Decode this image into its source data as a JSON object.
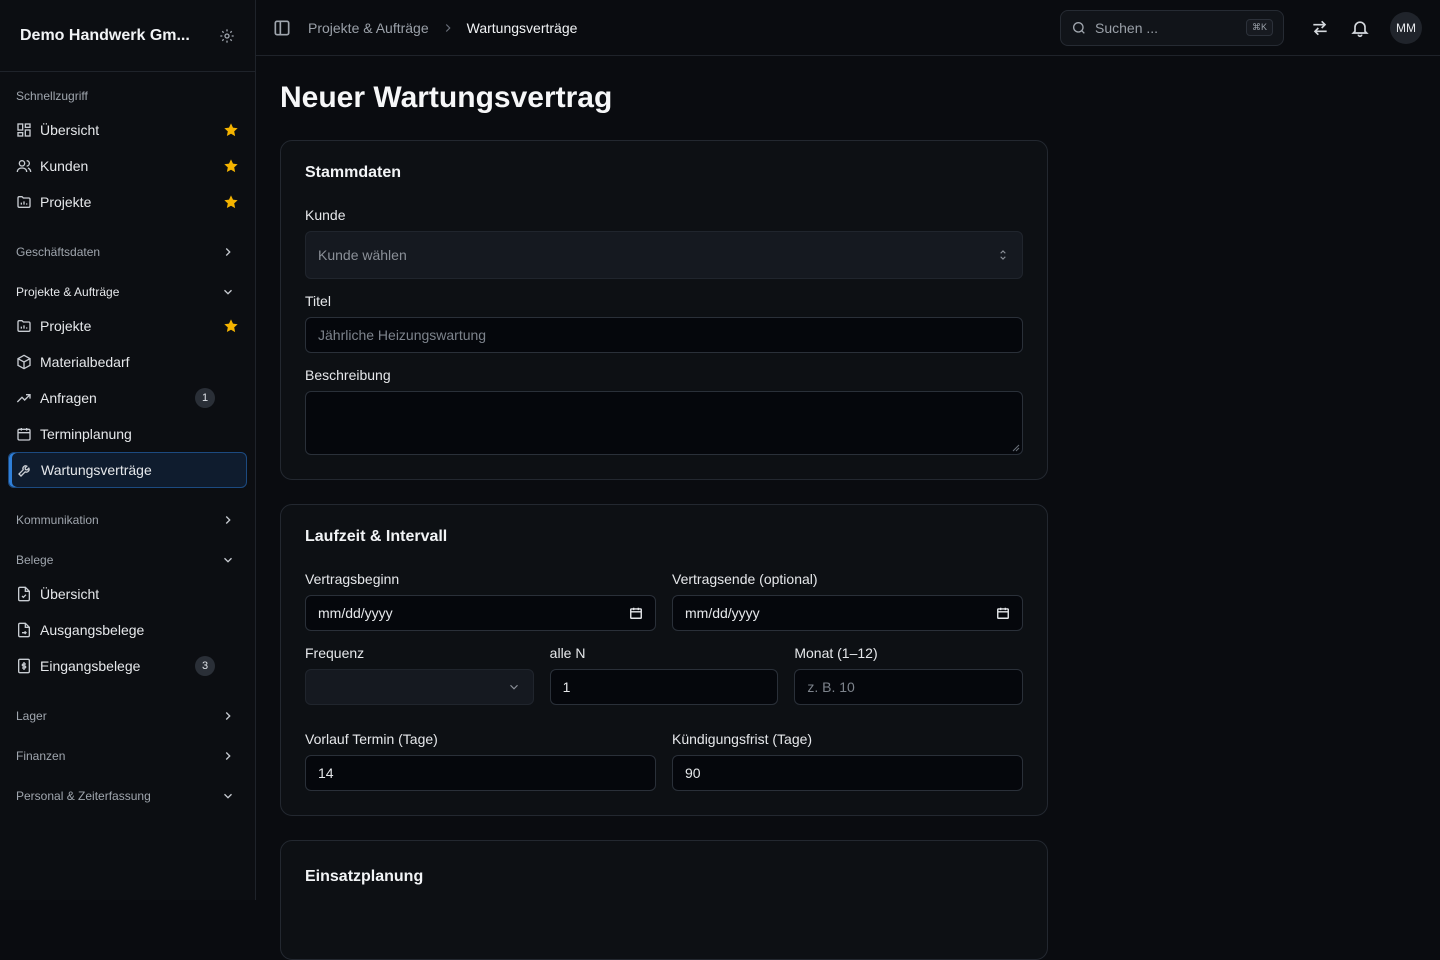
{
  "sidebar": {
    "company": "Demo Handwerk Gm...",
    "quick_access": {
      "title": "Schnellzugriff",
      "items": [
        {
          "label": "Übersicht"
        },
        {
          "label": "Kunden"
        },
        {
          "label": "Projekte"
        }
      ]
    },
    "groups": {
      "business": "Geschäftsdaten",
      "projects": {
        "title": "Projekte & Aufträge",
        "items": [
          {
            "label": "Projekte"
          },
          {
            "label": "Materialbedarf"
          },
          {
            "label": "Anfragen",
            "badge": "1"
          },
          {
            "label": "Terminplanung"
          },
          {
            "label": "Wartungsverträge"
          }
        ]
      },
      "communication": "Kommunikation",
      "documents": {
        "title": "Belege",
        "items": [
          {
            "label": "Übersicht"
          },
          {
            "label": "Ausgangsbelege"
          },
          {
            "label": "Eingangsbelege",
            "badge": "3"
          }
        ]
      },
      "stock": "Lager",
      "finance": "Finanzen",
      "personnel": "Personal & Zeiterfassung"
    }
  },
  "topbar": {
    "breadcrumb": [
      "Projekte & Aufträge",
      "Wartungsverträge"
    ],
    "search_placeholder": "Suchen ...",
    "search_shortcut": "⌘K",
    "avatar_initials": "MM"
  },
  "page": {
    "title": "Neuer Wartungsvertrag",
    "master": {
      "title": "Stammdaten",
      "customer_label": "Kunde",
      "customer_placeholder": "Kunde wählen",
      "title_label": "Titel",
      "title_placeholder": "Jährliche Heizungswartung",
      "description_label": "Beschreibung"
    },
    "term": {
      "title": "Laufzeit & Intervall",
      "start_label": "Vertragsbeginn",
      "start_value": "mm/dd/yyyy",
      "end_label": "Vertragsende (optional)",
      "end_value": "mm/dd/yyyy",
      "frequency_label": "Frequenz",
      "every_n_label": "alle N",
      "every_n_value": "1",
      "month_label": "Monat (1–12)",
      "month_placeholder": "z. B. 10",
      "lead_label": "Vorlauf Termin (Tage)",
      "lead_value": "14",
      "notice_label": "Kündigungsfrist (Tage)",
      "notice_value": "90"
    },
    "planning": {
      "title": "Einsatzplanung"
    }
  },
  "colors": {
    "accent": "#2f7fd8",
    "star": "#f5b400",
    "background": "#0a0c10"
  }
}
